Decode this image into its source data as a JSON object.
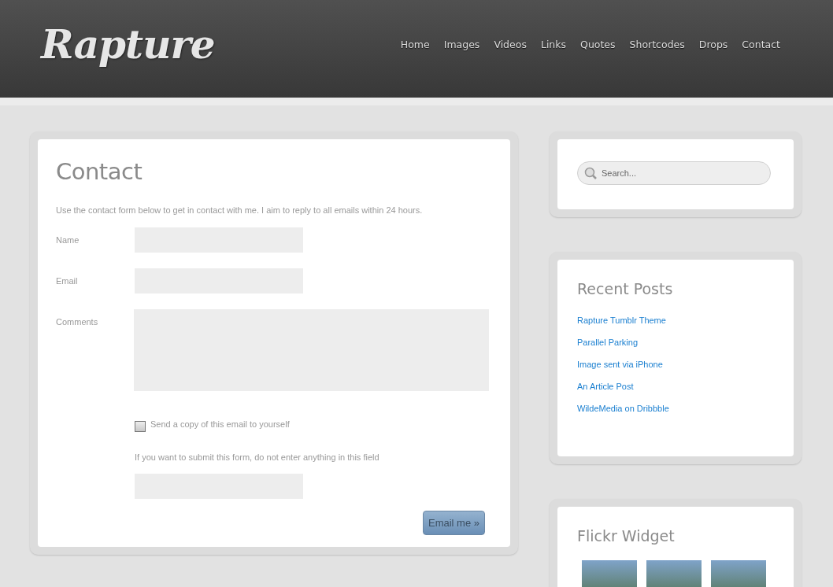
{
  "header": {
    "logo": "Rapture",
    "nav": [
      "Home",
      "Images",
      "Videos",
      "Links",
      "Quotes",
      "Shortcodes",
      "Drops",
      "Contact"
    ]
  },
  "page": {
    "title": "Contact",
    "intro": "Use the contact form below to get in contact with me. I aim to reply to all emails within 24 hours.",
    "fields": [
      {
        "label": "Name",
        "kind": "input"
      },
      {
        "label": "Email",
        "kind": "input"
      },
      {
        "label": "Comments",
        "kind": "textarea"
      }
    ],
    "copy_checkbox": {
      "label": "Send a copy of this email to yourself",
      "checked": false
    },
    "honeypot_hint": "If you want to submit this form, do not enter anything in this field",
    "submit": "Email me »"
  },
  "sidebar": {
    "search": {
      "placeholder": "Search..."
    },
    "recent_posts": {
      "title": "Recent Posts",
      "items": [
        "Rapture Tumblr Theme",
        "Parallel Parking",
        "Image sent via iPhone",
        "An Article Post",
        "WildeMedia on Dribbble"
      ]
    },
    "flickr": {
      "title": "Flickr Widget",
      "photos": [
        {
          "kind": "photo"
        },
        {
          "kind": "photo"
        },
        {
          "kind": "photo"
        }
      ]
    }
  }
}
